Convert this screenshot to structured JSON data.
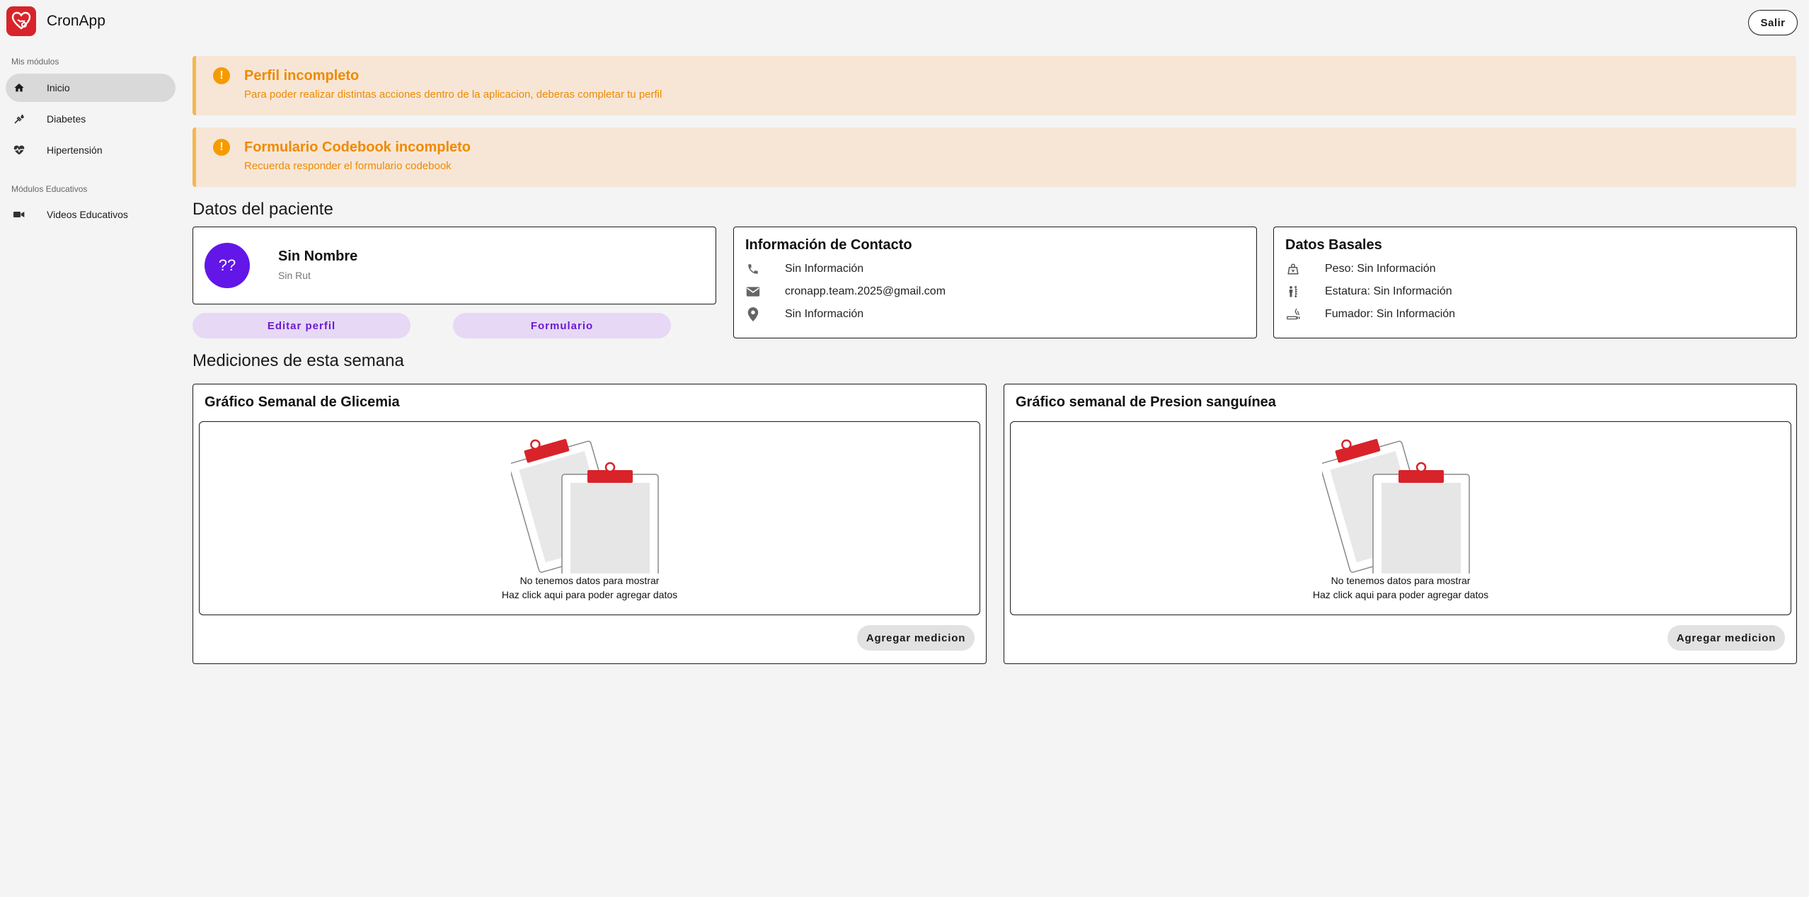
{
  "app": {
    "title": "CronApp",
    "logout_label": "Salir"
  },
  "sidebar": {
    "section_modules": "Mis módulos",
    "items": [
      {
        "label": "Inicio",
        "icon": "home-icon"
      },
      {
        "label": "Diabetes",
        "icon": "bloodtype-icon"
      },
      {
        "label": "Hipertensión",
        "icon": "monitor-heart-icon"
      }
    ],
    "section_education": "Módulos Educativos",
    "education_items": [
      {
        "label": "Videos Educativos",
        "icon": "videocam-icon"
      }
    ]
  },
  "alerts": [
    {
      "title": "Perfil incompleto",
      "text": "Para poder realizar distintas acciones dentro de la aplicacion, deberas completar tu perfil",
      "icon": "exclamation-icon"
    },
    {
      "title": "Formulario Codebook incompleto",
      "text": "Recuerda responder el formulario codebook",
      "icon": "exclamation-icon"
    }
  ],
  "patient": {
    "section_title": "Datos del paciente",
    "avatar_text": "??",
    "name": "Sin Nombre",
    "rut": "Sin Rut",
    "edit_label": "Editar perfil",
    "form_label": "Formulario"
  },
  "contact": {
    "title": "Información de Contacto",
    "phone": "Sin Información",
    "email": "cronapp.team.2025@gmail.com",
    "address": "Sin Información"
  },
  "basal": {
    "title": "Datos Basales",
    "weight": "Peso: Sin Información",
    "height": "Estatura: Sin Información",
    "smoker": "Fumador: Sin Información"
  },
  "measurements": {
    "section_title": "Mediciones de esta semana",
    "charts": [
      {
        "title": "Gráfico Semanal de Glicemia",
        "empty_line1": "No tenemos datos para mostrar",
        "empty_line2": "Haz click aqui para poder agregar datos",
        "add_label": "Agregar medicion"
      },
      {
        "title": "Gráfico semanal de Presion sanguínea",
        "empty_line1": "No tenemos datos para mostrar",
        "empty_line2": "Haz click aqui para poder agregar datos",
        "add_label": "Agregar medicion"
      }
    ]
  },
  "colors": {
    "brand": "#d8232a",
    "avatar": "#6316e8",
    "alert_bg": "#f7e6d6",
    "alert_text": "#ef8a00",
    "pill_bg": "#e7d8f6",
    "pill_text": "#6a1bcf"
  }
}
